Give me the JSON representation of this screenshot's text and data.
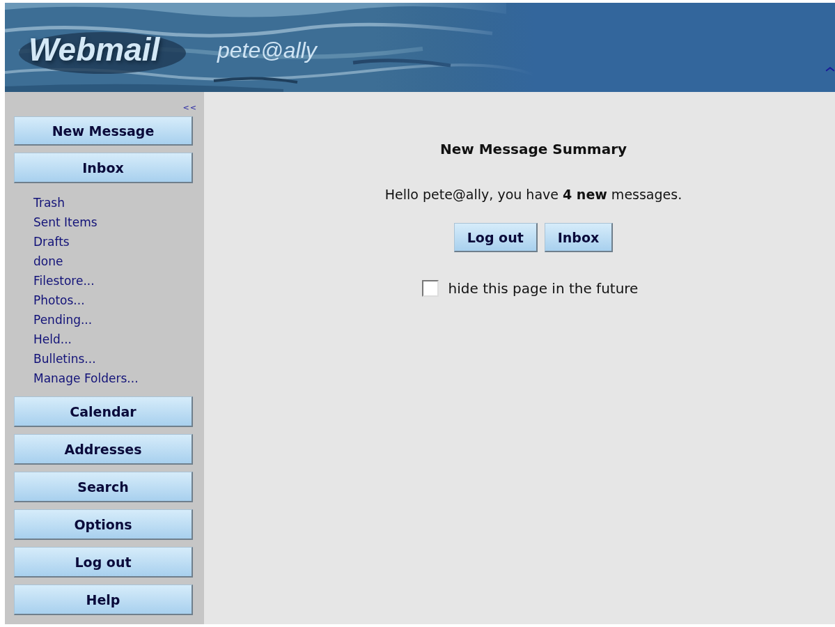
{
  "header": {
    "logo": "Webmail",
    "user": "pete@ally"
  },
  "sidebar": {
    "collapse": "<<",
    "top_buttons": [
      "New Message",
      "Inbox"
    ],
    "folders": [
      "Trash",
      "Sent Items",
      "Drafts",
      "done",
      "Filestore...",
      "Photos...",
      "Pending...",
      "Held...",
      "Bulletins...",
      "Manage Folders..."
    ],
    "bottom_buttons": [
      "Calendar",
      "Addresses",
      "Search",
      "Options",
      "Log out",
      "Help"
    ]
  },
  "summary": {
    "title": "New Message Summary",
    "message": "Hello pete@ally, you have **4 new** messages.",
    "buttons": [
      "Log out",
      "Inbox"
    ],
    "hide_option": {
      "label": "hide this page in the future",
      "checked": false
    }
  }
}
